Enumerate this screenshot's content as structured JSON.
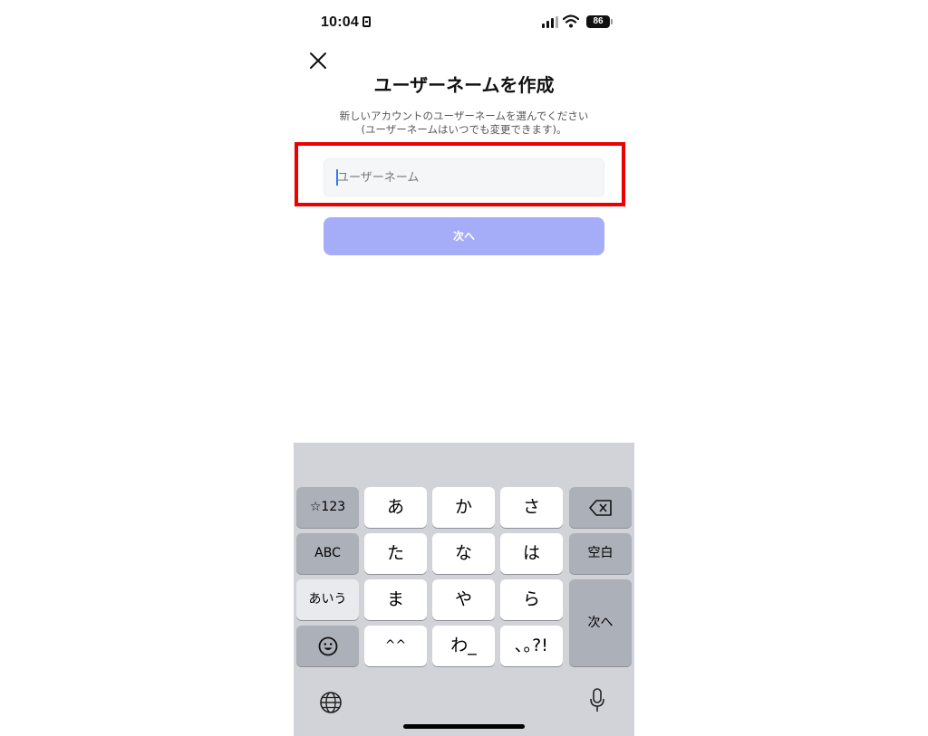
{
  "status_bar": {
    "time": "10:04",
    "battery": "86"
  },
  "header": {
    "title": "ユーザーネームを作成",
    "subtitle_line1": "新しいアカウントのユーザーネームを選んでください",
    "subtitle_line2": "(ユーザーネームはいつでも変更できます)。"
  },
  "form": {
    "username_placeholder": "ユーザーネーム",
    "username_value": "",
    "next_label": "次へ"
  },
  "keyboard": {
    "row1": [
      "☆123",
      "あ",
      "か",
      "さ"
    ],
    "row2": [
      "ABC",
      "た",
      "な",
      "は",
      "空白"
    ],
    "row3": [
      "あいう",
      "ま",
      "や",
      "ら"
    ],
    "row4": [
      "^^",
      "わ_",
      "､｡?!"
    ],
    "enter_label": "次へ"
  },
  "icons": {
    "close": "close-icon",
    "delete": "backspace-icon",
    "emoji": "emoji-icon",
    "globe": "globe-icon",
    "mic": "microphone-icon"
  },
  "colors": {
    "highlight": "#ee0000",
    "button_disabled": "#a6adf8",
    "caret": "#2e7cf6"
  }
}
